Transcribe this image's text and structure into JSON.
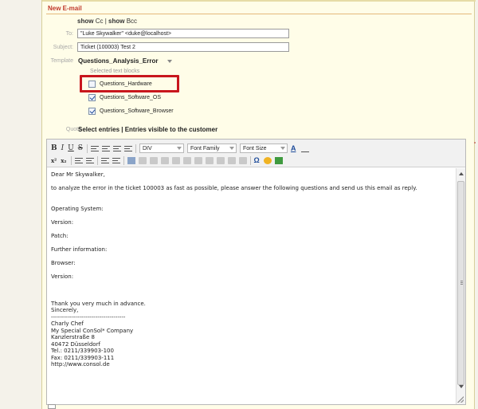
{
  "form": {
    "title": "New E-mail",
    "show_cc": "show",
    "cc_label": "Cc",
    "separator": "|",
    "show_bcc": "show",
    "bcc_label": "Bcc",
    "to_label": "To:",
    "to_value": "\"Luke Skywalker\" <duke@localhost>",
    "subject_label": "Subject:",
    "subject_value": "Ticket (100003) Test 2",
    "template_label": "Template",
    "template_value": "Questions_Analysis_Error",
    "selected_blocks_label": "Selected text blocks",
    "blocks": [
      {
        "label": "Questions_Hardware",
        "checked": false
      },
      {
        "label": "Questions_Software_OS",
        "checked": true
      },
      {
        "label": "Questions_Software_Browser",
        "checked": true
      }
    ],
    "quote_label": "Quote",
    "quote_text": "Select entries | Entries visible to the customer"
  },
  "toolbar": {
    "bold": "B",
    "italic": "I",
    "underline": "U",
    "strike": "S",
    "format_value": "DIV",
    "font_family": "Font Family",
    "font_size": "Font Size",
    "font_color": "A",
    "superscript": "x²",
    "subscript": "x₂",
    "omega": "Ω"
  },
  "body": {
    "lines": [
      "Dear Mr Skywalker,",
      "",
      "to analyze the error in the ticket 100003 as fast as possible, please answer the following questions and send us this email as reply.",
      "",
      "",
      "Operating System:",
      "",
      "Version:",
      "",
      "Patch:",
      "",
      "Further information:",
      "",
      "Browser:",
      "",
      "Version:",
      "",
      "",
      "",
      "Thank you very much in advance.",
      "Sincerely,",
      "-------------------------------------",
      "Charly Chef",
      "My Special ConSol* Company",
      "Kanzlerstraße 8",
      "40472 Düsseldorf",
      "Tel.: 0211/339903-100",
      "Fax: 0211/339903-111",
      "http://www.consol.de"
    ]
  }
}
